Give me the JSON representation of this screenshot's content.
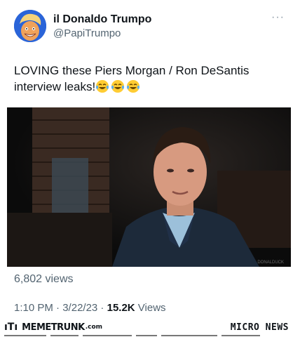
{
  "tweet": {
    "display_name": "il Donaldo Trumpo",
    "handle": "@PapiTrumpo",
    "more_label": "···",
    "text": "LOVING these Piers Morgan / Ron DeSantis interview leaks!",
    "emojis": [
      "laughing-with-tears-emoji",
      "laughing-with-tears-emoji",
      "laughing-with-tears-emoji"
    ],
    "media_watermark": "DONALDUCK",
    "views_label": "6,802 views",
    "time": "1:10 PM",
    "date": "3/22/23",
    "separator": " · ",
    "view_count": "15.2K",
    "views_word": " Views"
  },
  "footer": {
    "brand": "MEMETRUNK",
    "brand_domain": ".com",
    "micro_news": "MICRO NEWS"
  },
  "colors": {
    "text": "#0f1419",
    "secondary": "#536471",
    "media_bg": "#0d0d0d"
  }
}
